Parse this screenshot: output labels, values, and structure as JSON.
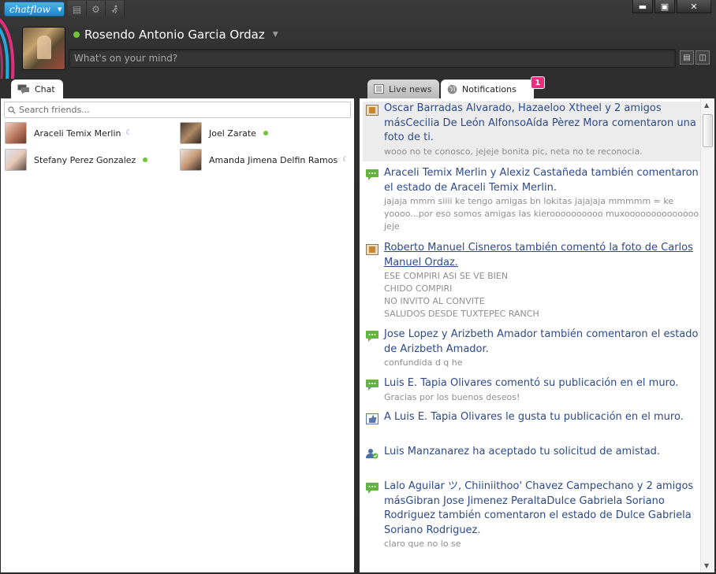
{
  "app": {
    "brand": "chatflow"
  },
  "profile": {
    "name": "Rosendo Antonio Garcia Ordaz",
    "status_placeholder": "What's on your mind?"
  },
  "tabs": {
    "chat": "Chat",
    "live_news": "Live news",
    "notifications": "Notifications",
    "notifications_count": "1"
  },
  "chat": {
    "search_placeholder": "Search friends...",
    "friends": [
      {
        "name": "Araceli Temix Merlin",
        "status": "away"
      },
      {
        "name": "Joel Zarate",
        "status": "online"
      },
      {
        "name": "Stefany Perez Gonzalez",
        "status": "online"
      },
      {
        "name": "Amanda Jimena Delfin Ramos",
        "status": "away"
      }
    ]
  },
  "notifications": [
    {
      "icon": "photo-icon",
      "title": "Oscar Barradas Alvarado, Hazaeloo Xtheel y 2 amigos másCecilia De León AlfonsoAída Pèrez Mora comentaron una foto de ti.",
      "body": "wooo no te conosco, jejeje bonita pic, neta no te reconocia."
    },
    {
      "icon": "comment-icon",
      "title": "Araceli Temix Merlin y Alexiz Castañeda también comentaron el estado de Araceli Temix Merlin.",
      "body": "jajaja mmm siiii ke tengo amigas bn lokitas jajajaja  mmmmm = ke yoooo...por eso somos amigas  las kieroooooooooo muxoooooooooooooo  jeje"
    },
    {
      "icon": "photo-icon",
      "title": "Roberto Manuel Cisneros también comentó la foto de Carlos Manuel Ordaz.",
      "body": "ESE COMPIRI ASI SE VE BIEN\nCHIDO COMPIRI\nNO  INVITO AL CONVITE\nSALUDOS DESDE TUXTEPEC RANCH"
    },
    {
      "icon": "comment-icon",
      "title": "Jose Lopez y Arizbeth Amador también comentaron el estado de Arizbeth Amador.",
      "body": "confundida d q he"
    },
    {
      "icon": "comment-icon",
      "title": "Luis E. Tapia Olivares comentó su publicación en el muro.",
      "body": "Gracias por los buenos deseos!"
    },
    {
      "icon": "like-icon",
      "title": "A Luis E. Tapia Olivares le gusta tu publicación en el muro.",
      "body": ""
    },
    {
      "icon": "friend-icon",
      "title": "Luis Manzanarez ha aceptado tu solicitud de amistad.",
      "body": ""
    },
    {
      "icon": "comment-icon",
      "title": "Lalo Aguilar ツ, Chiiniithoo' Chavez Campechano y 2 amigos másGibran Jose Jimenez PeraltaDulce Gabriela Soriano Rodriguez también comentaron el estado de Dulce Gabriela Soriano Rodriguez.",
      "body": "claro que no lo se"
    }
  ],
  "colors": {
    "accent": "#1e86c7",
    "link": "#2d4a8a",
    "online": "#6fc437",
    "badge": "#e5307f"
  }
}
